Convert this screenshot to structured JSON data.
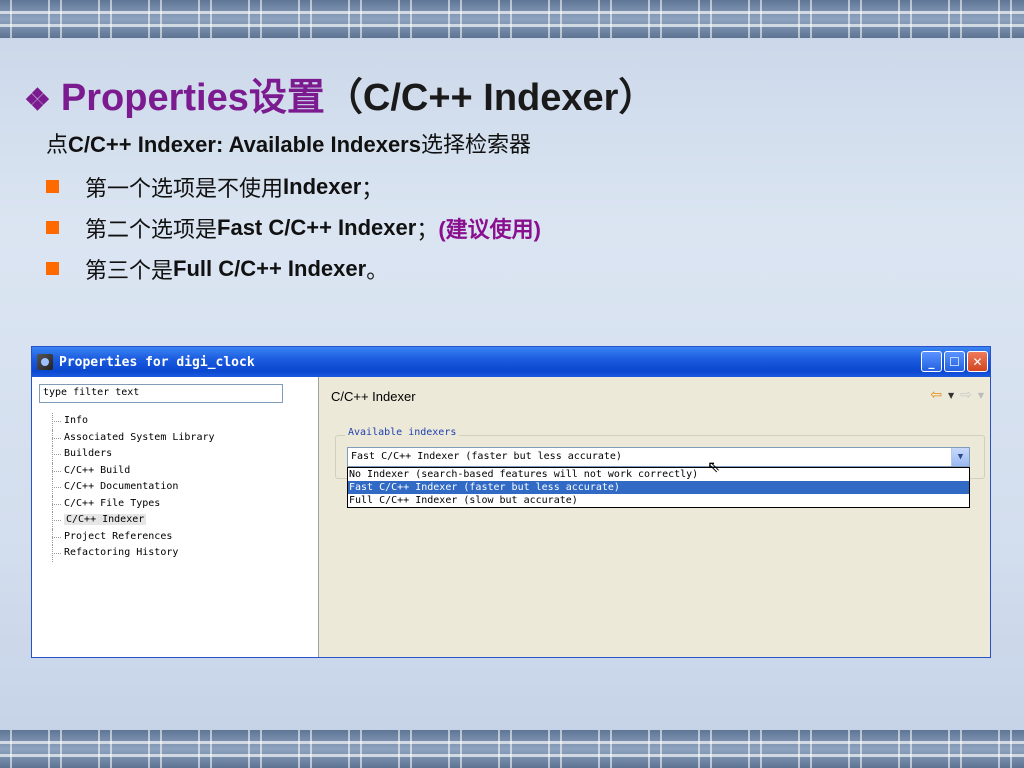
{
  "slide": {
    "title_main": "Properties设置",
    "title_paren": "（C/C++ Indexer）",
    "intro_prefix": "点",
    "intro_bold": "C/C++ Indexer: Available Indexers",
    "intro_suffix": "选择检索器",
    "bullets": [
      {
        "prefix": "第一个选项是不使用",
        "bold": "Indexer",
        "suffix": "；",
        "extra": ""
      },
      {
        "prefix": "第二个选项是",
        "bold": "Fast C/C++ Indexer",
        "suffix": "；",
        "extra": "(建议使用)"
      },
      {
        "prefix": "第三个是",
        "bold": "Full C/C++ Indexer",
        "suffix": "。",
        "extra": ""
      }
    ]
  },
  "window": {
    "title": "Properties for digi_clock",
    "filter_placeholder": "type filter text",
    "tree": [
      "Info",
      "Associated System Library",
      "Builders",
      "C/C++ Build",
      "C/C++ Documentation",
      "C/C++ File Types",
      "C/C++ Indexer",
      "Project References",
      "Refactoring History"
    ],
    "selected_tree_index": 6,
    "page_title": "C/C++ Indexer",
    "group_label": "Available indexers",
    "combo_value": "Fast C/C++ Indexer (faster but less accurate)",
    "options": [
      "No Indexer (search-based features will not work correctly)",
      "Fast C/C++ Indexer (faster but less accurate)",
      "Full C/C++ Indexer (slow but accurate)"
    ],
    "highlighted_option_index": 1
  },
  "colors": {
    "title": "#7b1b8f",
    "bullet": "#ff6a00",
    "highlight": "#316ac5"
  }
}
